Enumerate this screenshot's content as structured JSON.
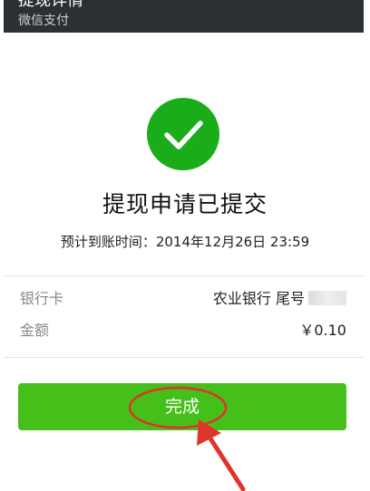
{
  "header": {
    "title": "提现详情",
    "subtitle": "微信支付"
  },
  "result": {
    "icon": "check-circle-icon",
    "headline": "提现申请已提交",
    "eta": "预计到账时间：2014年12月26日 23:59"
  },
  "details": {
    "bank_card_label": "银行卡",
    "bank_card_value": "农业银行 尾号",
    "amount_label": "金额",
    "amount_value": "￥0.10"
  },
  "done_button": {
    "label": "完成"
  },
  "colors": {
    "header_bg": "#2c2f33",
    "success_green": "#1aad19",
    "button_green": "#45c01a",
    "annotation_red": "#e0332b"
  }
}
